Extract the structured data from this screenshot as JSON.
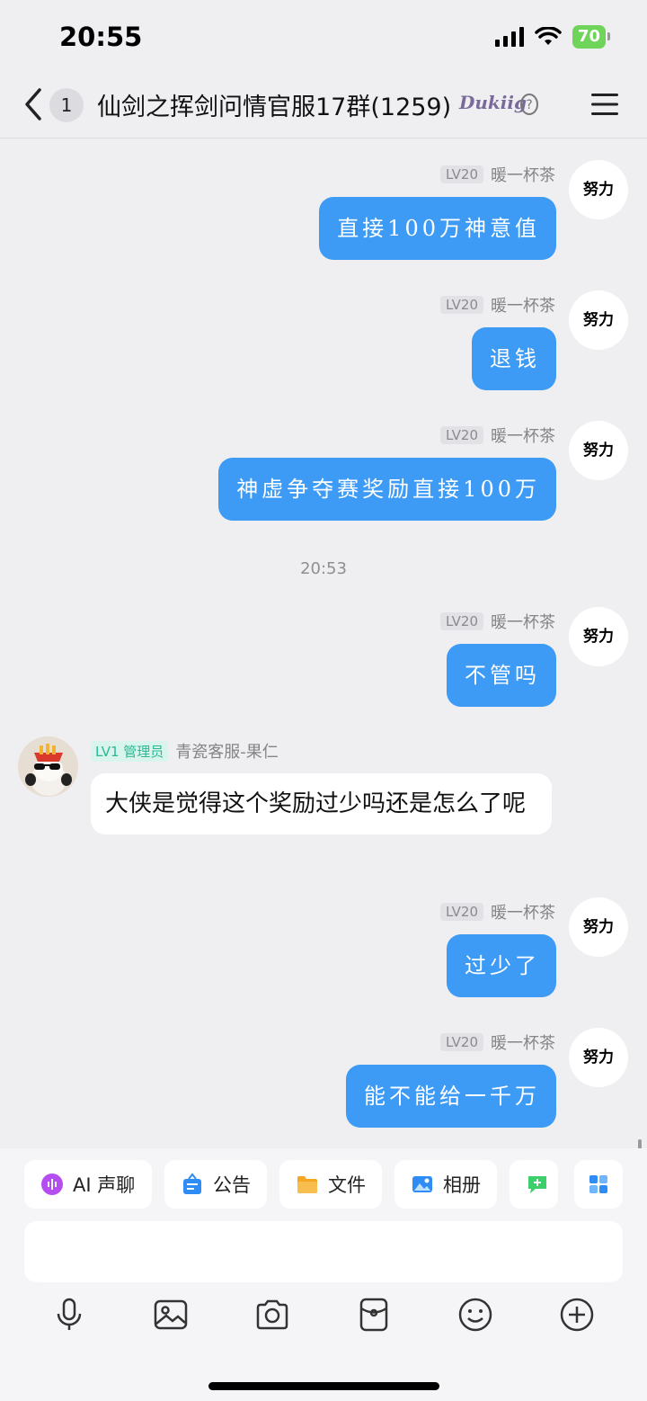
{
  "status_bar": {
    "time": "20:55",
    "battery": "70"
  },
  "header": {
    "unread_count": "1",
    "title": "仙剑之挥剑问情官服17群(1259)",
    "title_badge": "Dukiig"
  },
  "messages": [
    {
      "side": "right",
      "level": "LV20",
      "nickname": "暖一杯茶",
      "avatar_text": "努力",
      "text": "直接100万神意值"
    },
    {
      "side": "right",
      "level": "LV20",
      "nickname": "暖一杯茶",
      "avatar_text": "努力",
      "text": "退钱"
    },
    {
      "side": "right",
      "level": "LV20",
      "nickname": "暖一杯茶",
      "avatar_text": "努力",
      "text": "神虚争夺赛奖励直接100万"
    },
    {
      "time_divider": "20:53"
    },
    {
      "side": "right",
      "level": "LV20",
      "nickname": "暖一杯茶",
      "avatar_text": "努力",
      "text": "不管吗"
    },
    {
      "side": "left",
      "level": "LV1",
      "role": "管理员",
      "nickname": "青瓷客服-果仁",
      "text": "大侠是觉得这个奖励过少吗还是怎么了呢"
    },
    {
      "side": "right",
      "level": "LV20",
      "nickname": "暖一杯茶",
      "avatar_text": "努力",
      "text": "过少了"
    },
    {
      "side": "right",
      "level": "LV20",
      "nickname": "暖一杯茶",
      "avatar_text": "努力",
      "text": "能不能给一千万"
    }
  ],
  "quick_actions": [
    {
      "label": "AI 声聊",
      "icon": "ai-voice-icon",
      "color": "#b44ef0"
    },
    {
      "label": "公告",
      "icon": "announcement-icon",
      "color": "#2f8cf5"
    },
    {
      "label": "文件",
      "icon": "folder-icon",
      "color": "#f5a623"
    },
    {
      "label": "相册",
      "icon": "album-icon",
      "color": "#2f8cf5"
    },
    {
      "label": "",
      "icon": "add-chat-icon",
      "color": "#3ccf6b"
    }
  ],
  "toolbar": [
    "microphone-icon",
    "image-icon",
    "camera-icon",
    "red-packet-icon",
    "emoji-icon",
    "plus-icon"
  ],
  "colors": {
    "bubble_right": "#3d9bf5",
    "background": "#efeff2"
  }
}
